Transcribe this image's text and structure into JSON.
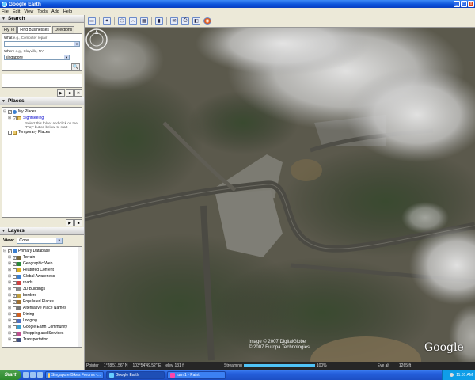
{
  "window": {
    "title": "Google Earth",
    "btn_min": "_",
    "btn_max": "□",
    "btn_close": "x"
  },
  "menu": [
    "File",
    "Edit",
    "View",
    "Tools",
    "Add",
    "Help"
  ],
  "search": {
    "header": "Search",
    "tabs": [
      "Fly To",
      "Find Businesses",
      "Directions"
    ],
    "what_label": "What",
    "what_hint": "e.g., Computer repair",
    "what_value": "",
    "where_label": "Where",
    "where_hint": "e.g., Clayville, NY",
    "where_value": "singapore"
  },
  "places": {
    "header": "Places",
    "items": [
      {
        "label": "My Places",
        "checked": true
      },
      {
        "label": "Sightseeing",
        "checked": true
      },
      {
        "label": "Select this folder and click on the 'Play' button below, to start"
      },
      {
        "label": "Temporary Places",
        "checked": false
      }
    ]
  },
  "layers": {
    "header": "Layers",
    "view_label": "View:",
    "view_value": "Core",
    "items": [
      {
        "label": "Primary Database",
        "checked": true
      },
      {
        "label": "Terrain",
        "checked": true
      },
      {
        "label": "Geographic Web",
        "checked": true
      },
      {
        "label": "Featured Content",
        "checked": false
      },
      {
        "label": "Global Awareness",
        "checked": false
      },
      {
        "label": "roads",
        "checked": false
      },
      {
        "label": "3D Buildings",
        "checked": false
      },
      {
        "label": "borders",
        "checked": true
      },
      {
        "label": "Populated Places",
        "checked": true
      },
      {
        "label": "Alternative Place Names",
        "checked": false
      },
      {
        "label": "Dining",
        "checked": false
      },
      {
        "label": "Lodging",
        "checked": false
      },
      {
        "label": "Google Earth Community",
        "checked": false
      },
      {
        "label": "Shopping and Services",
        "checked": false
      },
      {
        "label": "Transportation",
        "checked": false
      }
    ]
  },
  "map": {
    "copyright_1": "Image © 2007 DigitalGlobe",
    "copyright_2": "© 2007 Europa Technologies",
    "logo": "Google"
  },
  "status": {
    "pointer": "Pointer",
    "lat": "1°28'51.56\" N",
    "lon": "103°54'49.52\" E",
    "elev": "elev",
    "elev_value": "131 ft",
    "streaming": "Streaming",
    "stream_pct": "100%",
    "stream_fraction": 1.0,
    "eye_alt": "Eye alt",
    "eye_alt_value": "1265 ft"
  },
  "taskbar": {
    "start": "Start",
    "tasks": [
      "Singapore Bikes Forums -...",
      "Google Earth",
      "turn 1 - Paint"
    ],
    "clock": "11:31 AM"
  }
}
